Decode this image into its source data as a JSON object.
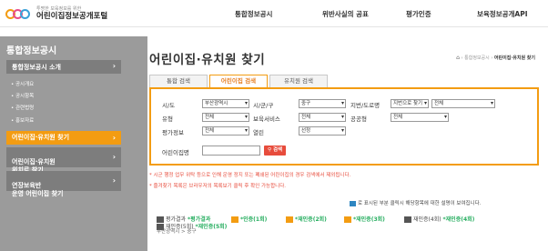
{
  "header": {
    "logo_sub": "투명한 보육정보를 위한",
    "logo_main": "어린이집정보공개포털",
    "nav": [
      "통합정보공시",
      "위반사실의 공표",
      "평가인증",
      "보육정보공개API"
    ]
  },
  "sidebar": {
    "title": "통합정보공시",
    "main_label": "통합정보공시 소개",
    "sub_items": [
      "공시개요",
      "공시항목",
      "관련법령",
      "홍보자료"
    ],
    "menu": [
      {
        "label": "어린이집·유치원 찾기",
        "active": true
      },
      {
        "label": "어린이집·유치원\n위치로 찾기",
        "active": false
      },
      {
        "label": "연장보육반\n운영 어린이집 찾기",
        "active": false
      }
    ]
  },
  "main": {
    "title": "어린이집·유치원 찾기",
    "breadcrumb": [
      "통합정보공시",
      "어린이집·유치원 찾기"
    ],
    "tabs": [
      "통합 검색",
      "어린이집 검색",
      "유치원 검색"
    ],
    "active_tab": 1
  },
  "search": {
    "labels": {
      "sido": "시/도",
      "sigungu": "시/군/구",
      "road": "지번/도로명",
      "type": "유형",
      "service": "보육서비스",
      "public": "공공형",
      "eval": "평가정보",
      "open": "열린",
      "name": "어린이집명"
    },
    "values": {
      "sido": "부산광역시",
      "sigungu": "중구",
      "road": "지번으로 찾기",
      "road_detail": "전체",
      "type": "전체",
      "service": "전체",
      "public": "전체",
      "eval": "전체",
      "open": "선정"
    },
    "button_label": "검색"
  },
  "notices": [
    "* 시군 행정 업무 위탁 등으로 인해 운영 정지 또는 폐쇄된 어린이집의 경우 검색에서 제외됩니다.",
    "* 즐겨찾기 목록은 브라우저의 목록보기 클릭 후 확인 가능합니다."
  ],
  "legend": {
    "hint": "로 표시된 부분 클릭시 해당항목에 대한 설명이 보여집니다.",
    "row": [
      {
        "prefix": "평가결과",
        "label": "*평가결과",
        "color": "#27ae60"
      },
      {
        "prefix": "",
        "label": "*인증(1회)",
        "color": "#27ae60"
      },
      {
        "prefix": "",
        "label": "*재인증(2회)",
        "color": "#27ae60"
      },
      {
        "prefix": "",
        "label": "*재인증(3회)",
        "color": "#27ae60"
      },
      {
        "prefix": "재인증(4회)",
        "label": "*재인증(4회)",
        "color": "#27ae60"
      }
    ],
    "row2_a": "재인증(5회)",
    "row2_b": "*재인증(5회)",
    "address": "부산광역시 > 중구"
  }
}
